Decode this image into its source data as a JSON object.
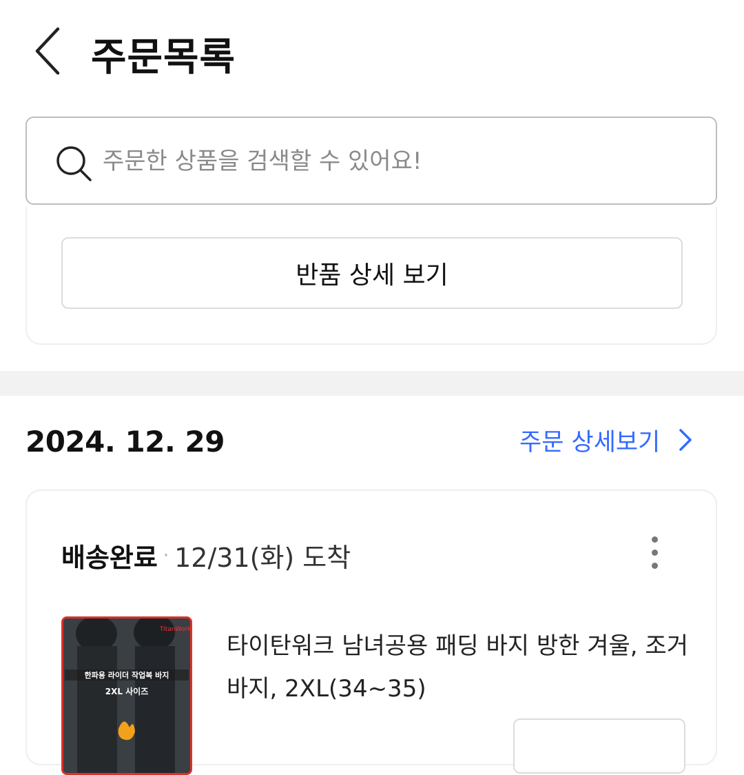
{
  "header": {
    "title": "주문목록",
    "back_icon": "chevron-left-icon"
  },
  "search": {
    "placeholder": "주문한 상품을 검색할 수 있어요!",
    "icon": "search-icon"
  },
  "previous_order": {
    "return_detail_label": "반품 상세 보기"
  },
  "order": {
    "date": "2024. 12. 29",
    "detail_link_label": "주문 상세보기",
    "status": "배송완료",
    "separator": "·",
    "arrival": "12/31(화) 도착",
    "product_name": "타이탄워크 남녀공용 패딩 바지 방한 겨울, 조거바지, 2XL(34~35)",
    "thumbnail_text": {
      "brand": "TitanWork",
      "headline": "한파용 라이더 작업복 바지",
      "size": "2XL 사이즈"
    }
  },
  "colors": {
    "accent": "#346aff",
    "thumbnail_border": "#d9322b",
    "band": "#f2f2f2"
  }
}
